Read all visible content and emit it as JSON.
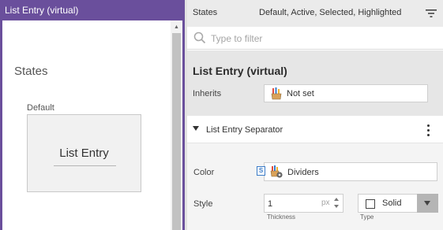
{
  "preview": {
    "title": "List Entry (virtual)",
    "states_heading": "States",
    "default_label": "Default",
    "entry_text": "List Entry"
  },
  "properties": {
    "states_label": "States",
    "states_value": "Default, Active, Selected, Highlighted",
    "filter_placeholder": "Type to filter",
    "class_title": "List Entry (virtual)",
    "inherits_label": "Inherits",
    "inherits_value": "Not set",
    "section_title": "List Entry Separator",
    "color_label": "Color",
    "color_style_badge": "S",
    "color_value": "Dividers",
    "style_label": "Style",
    "thickness_value": "1",
    "thickness_unit": "px",
    "thickness_caption": "Thickness",
    "style_value": "Solid",
    "type_caption": "Type"
  },
  "icons": {
    "filter": "filter-lines-icon",
    "search": "search-icon",
    "inherits": "pencil-cup-icon",
    "color": "pencil-cup-gear-icon",
    "collapse": "triangle-down-icon",
    "menu": "kebab-menu-icon",
    "dropdown": "chevron-down-icon"
  },
  "colors": {
    "accent": "#6a4f9c",
    "section_bg": "#e6e6e6",
    "link_blue": "#3a7bc8"
  }
}
